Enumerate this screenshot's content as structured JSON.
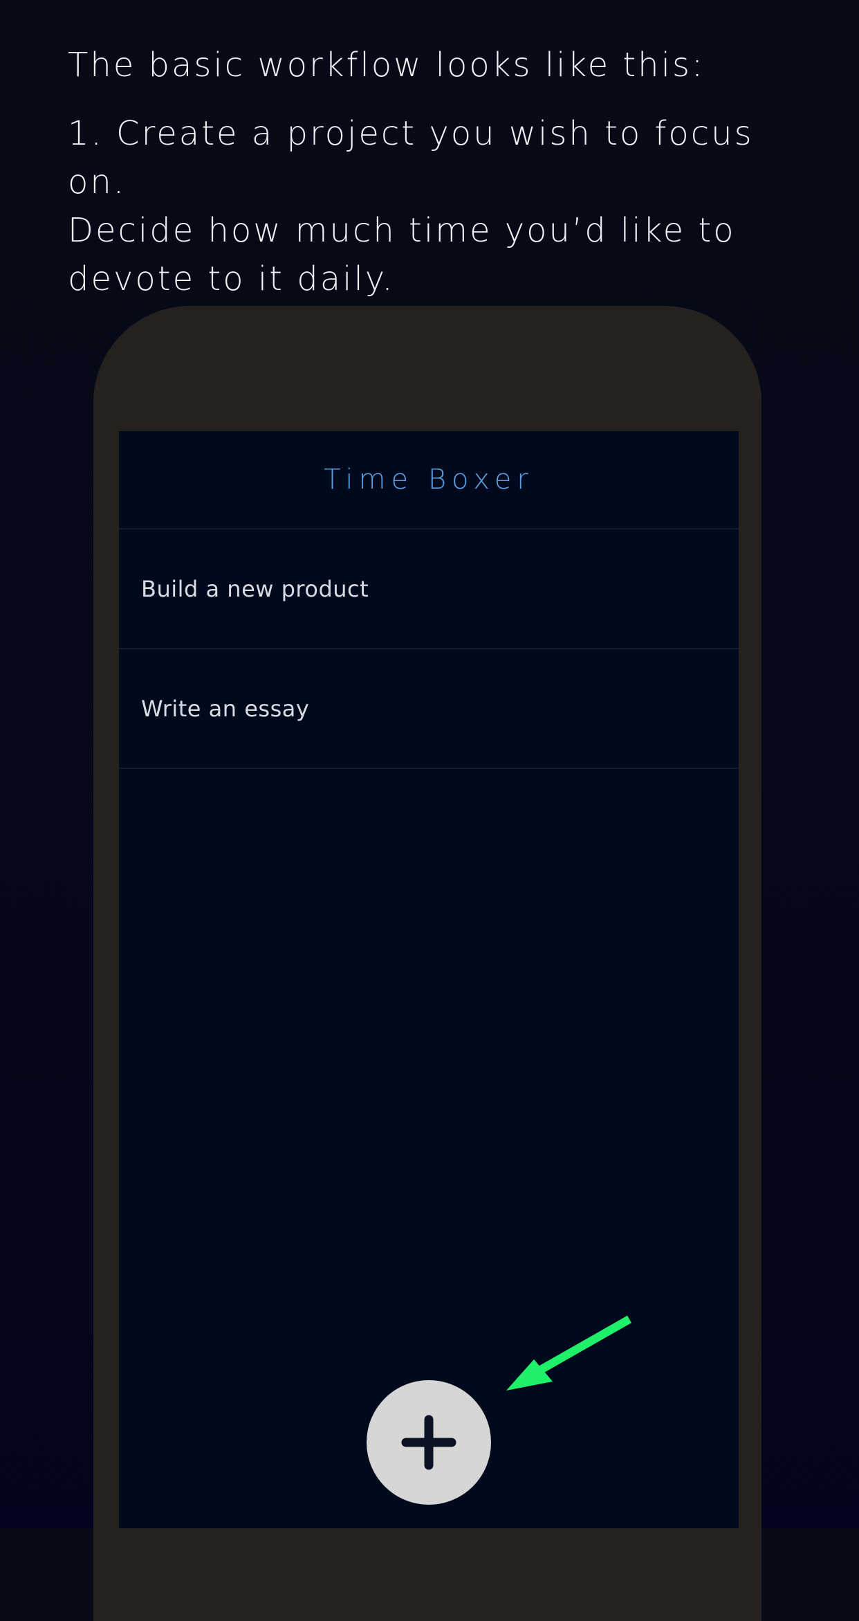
{
  "intro": {
    "heading": "The basic workflow looks like this:",
    "step1_line1": "1. Create a project you wish to focus on.",
    "step1_line2": "Decide how much time you’d like to",
    "step1_line3": "devote to it daily."
  },
  "app": {
    "title": "Time Boxer",
    "projects": [
      {
        "label": "Build a new product"
      },
      {
        "label": "Write an essay"
      }
    ]
  },
  "icons": {
    "add": "plus-icon",
    "pointer": "green-arrow-icon"
  },
  "colors": {
    "background": "#050a18",
    "phone_frame": "#25211f",
    "screen": "#010a1c",
    "accent_title": "#5e9ee0",
    "add_button": "#d6d6d6",
    "plus_glyph": "#0a1224",
    "arrow": "#1ef06a"
  }
}
